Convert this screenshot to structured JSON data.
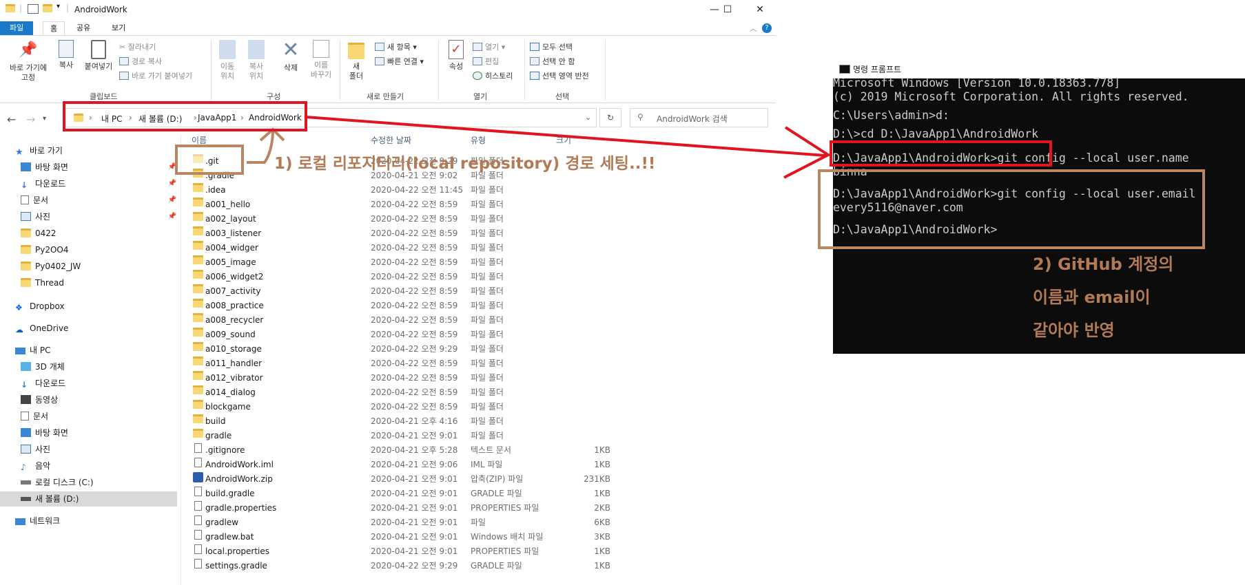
{
  "explorer": {
    "window_title": "AndroidWork",
    "ribbon_tabs": [
      "파일",
      "홈",
      "공유",
      "보기"
    ],
    "clipboard": {
      "group_label": "클립보드",
      "pin_label_1": "바로 가기에",
      "pin_label_2": "고정",
      "copy": "복사",
      "paste": "붙여넣기",
      "cut": "잘라내기",
      "copy_path": "경로 복사",
      "paste_shortcut": "바로 가기 붙여넣기"
    },
    "organize": {
      "group_label": "구성",
      "move_1": "이동",
      "move_2": "위치",
      "copyto_1": "복사",
      "copyto_2": "위치",
      "delete": "삭제",
      "rename_1": "이름",
      "rename_2": "바꾸기"
    },
    "new": {
      "group_label": "새로 만들기",
      "folder_1": "새",
      "folder_2": "폴더",
      "new_item": "새 항목",
      "easy_access": "빠른 연결"
    },
    "open": {
      "group_label": "열기",
      "properties": "속성",
      "open": "열기",
      "edit": "편집",
      "history": "히스토리"
    },
    "select": {
      "group_label": "선택",
      "select_all": "모두 선택",
      "select_none": "선택 안 함",
      "invert": "선택 영역 반전"
    },
    "address": {
      "crumbs": [
        "내 PC",
        "새 볼륨 (D:)",
        "JavaApp1",
        "AndroidWork"
      ],
      "search_placeholder": "AndroidWork 검색"
    },
    "nav": {
      "quick_access": "바로 가기",
      "quick_items": [
        "바탕 화면",
        "다운로드",
        "문서",
        "사진",
        "0422",
        "Py2OO4",
        "Py0402_JW",
        "Thread"
      ],
      "dropbox": "Dropbox",
      "onedrive": "OneDrive",
      "this_pc": "내 PC",
      "pc_items": [
        "3D 개체",
        "다운로드",
        "동영상",
        "문서",
        "바탕 화면",
        "사진",
        "음악",
        "로컬 디스크 (C:)",
        "새 볼륨 (D:)"
      ],
      "network": "네트워크"
    },
    "columns": {
      "name": "이름",
      "date": "수정한 날짜",
      "type": "유형",
      "size": "크기"
    },
    "files": [
      {
        "name": ".git",
        "date": "2020-04-22 오전 9:29",
        "type": "파일 폴더",
        "size": "",
        "kind": "folder-hidden"
      },
      {
        "name": ".gradle",
        "date": "2020-04-21 오전 9:02",
        "type": "파일 폴더",
        "size": "",
        "kind": "folder"
      },
      {
        "name": ".idea",
        "date": "2020-04-22 오전 11:45",
        "type": "파일 폴더",
        "size": "",
        "kind": "folder"
      },
      {
        "name": "a001_hello",
        "date": "2020-04-22 오전 8:59",
        "type": "파일 폴더",
        "size": "",
        "kind": "folder"
      },
      {
        "name": "a002_layout",
        "date": "2020-04-22 오전 8:59",
        "type": "파일 폴더",
        "size": "",
        "kind": "folder"
      },
      {
        "name": "a003_listener",
        "date": "2020-04-22 오전 8:59",
        "type": "파일 폴더",
        "size": "",
        "kind": "folder"
      },
      {
        "name": "a004_widger",
        "date": "2020-04-22 오전 8:59",
        "type": "파일 폴더",
        "size": "",
        "kind": "folder"
      },
      {
        "name": "a005_image",
        "date": "2020-04-22 오전 8:59",
        "type": "파일 폴더",
        "size": "",
        "kind": "folder"
      },
      {
        "name": "a006_widget2",
        "date": "2020-04-22 오전 8:59",
        "type": "파일 폴더",
        "size": "",
        "kind": "folder"
      },
      {
        "name": "a007_activity",
        "date": "2020-04-22 오전 8:59",
        "type": "파일 폴더",
        "size": "",
        "kind": "folder"
      },
      {
        "name": "a008_practice",
        "date": "2020-04-22 오전 8:59",
        "type": "파일 폴더",
        "size": "",
        "kind": "folder"
      },
      {
        "name": "a008_recycler",
        "date": "2020-04-22 오전 8:59",
        "type": "파일 폴더",
        "size": "",
        "kind": "folder"
      },
      {
        "name": "a009_sound",
        "date": "2020-04-22 오전 8:59",
        "type": "파일 폴더",
        "size": "",
        "kind": "folder"
      },
      {
        "name": "a010_storage",
        "date": "2020-04-22 오전 9:29",
        "type": "파일 폴더",
        "size": "",
        "kind": "folder"
      },
      {
        "name": "a011_handler",
        "date": "2020-04-22 오전 8:59",
        "type": "파일 폴더",
        "size": "",
        "kind": "folder"
      },
      {
        "name": "a012_vibrator",
        "date": "2020-04-22 오전 8:59",
        "type": "파일 폴더",
        "size": "",
        "kind": "folder"
      },
      {
        "name": "a014_dialog",
        "date": "2020-04-22 오전 8:59",
        "type": "파일 폴더",
        "size": "",
        "kind": "folder"
      },
      {
        "name": "blockgame",
        "date": "2020-04-22 오전 8:59",
        "type": "파일 폴더",
        "size": "",
        "kind": "folder"
      },
      {
        "name": "build",
        "date": "2020-04-21 오후 4:16",
        "type": "파일 폴더",
        "size": "",
        "kind": "folder"
      },
      {
        "name": "gradle",
        "date": "2020-04-21 오전 9:01",
        "type": "파일 폴더",
        "size": "",
        "kind": "folder"
      },
      {
        "name": ".gitignore",
        "date": "2020-04-21 오후 5:28",
        "type": "텍스트 문서",
        "size": "1KB",
        "kind": "doc"
      },
      {
        "name": "AndroidWork.iml",
        "date": "2020-04-21 오전 9:06",
        "type": "IML 파일",
        "size": "1KB",
        "kind": "doc"
      },
      {
        "name": "AndroidWork.zip",
        "date": "2020-04-21 오전 9:01",
        "type": "압축(ZIP) 파일",
        "size": "231KB",
        "kind": "zip"
      },
      {
        "name": "build.gradle",
        "date": "2020-04-21 오전 9:01",
        "type": "GRADLE 파일",
        "size": "1KB",
        "kind": "doc"
      },
      {
        "name": "gradle.properties",
        "date": "2020-04-21 오전 9:01",
        "type": "PROPERTIES 파일",
        "size": "2KB",
        "kind": "doc"
      },
      {
        "name": "gradlew",
        "date": "2020-04-21 오전 9:01",
        "type": "파일",
        "size": "6KB",
        "kind": "doc"
      },
      {
        "name": "gradlew.bat",
        "date": "2020-04-21 오전 9:01",
        "type": "Windows 배치 파일",
        "size": "3KB",
        "kind": "doc"
      },
      {
        "name": "local.properties",
        "date": "2020-04-21 오전 9:01",
        "type": "PROPERTIES 파일",
        "size": "1KB",
        "kind": "doc"
      },
      {
        "name": "settings.gradle",
        "date": "2020-04-22 오전 9:29",
        "type": "GRADLE 파일",
        "size": "1KB",
        "kind": "doc"
      }
    ]
  },
  "cmd": {
    "title": "명령 프롬프트",
    "lines": [
      "Microsoft Windows [Version 10.0.18363.778]",
      "(c) 2019 Microsoft Corporation. All rights reserved.",
      "",
      "C:\\Users\\admin>d:",
      "",
      "D:\\>cd D:\\JavaApp1\\AndroidWork",
      "",
      "D:\\JavaApp1\\AndroidWork>git config --local user.name",
      "binna",
      "",
      "D:\\JavaApp1\\AndroidWork>git config --local user.email",
      "every5116@naver.com",
      "",
      "D:\\JavaApp1\\AndroidWork>"
    ]
  },
  "annotations": {
    "step1": "1) 로컬 리포지터리(local repository) 경로 세팅..!!",
    "step2_line1": "2) GitHub 계정의",
    "step2_line2": "이름과 email이",
    "step2_line3": "같아야 반영",
    "colors": {
      "red": "#e0151f",
      "brown": "#b98562"
    }
  }
}
